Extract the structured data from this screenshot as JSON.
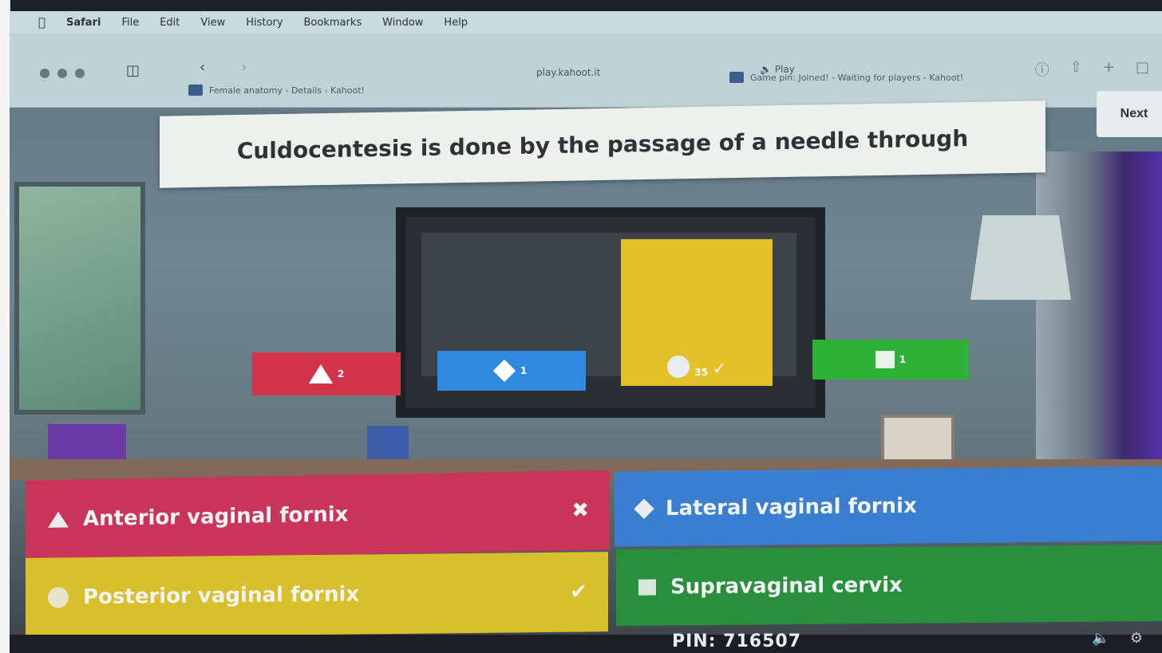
{
  "menubar": {
    "app": "Safari",
    "items": [
      "File",
      "Edit",
      "View",
      "History",
      "Bookmarks",
      "Window",
      "Help"
    ]
  },
  "toolbar": {
    "url": "play.kahoot.it",
    "audio": "Play",
    "tab_left": "Female anatomy - Details - Kahoot!",
    "tab_right": "Game pin: Joined! - Waiting for players - Kahoot!"
  },
  "question": {
    "text": "Culdocentesis is done by the passage of a needle through"
  },
  "next_button": "Next",
  "results": [
    {
      "shape": "triangle-icon",
      "count": "2",
      "color": "#d2324a"
    },
    {
      "shape": "diamond-icon",
      "count": "1",
      "color": "#2f8be0"
    },
    {
      "shape": "circle-icon",
      "count": "35",
      "correct": "✓",
      "color": "#e4c12a"
    },
    {
      "shape": "square-icon",
      "count": "1",
      "color": "#2fb037"
    }
  ],
  "answers": [
    {
      "label": "Anterior vaginal fornix",
      "mark": "✖",
      "color": "#c8345a"
    },
    {
      "label": "Lateral vaginal fornix",
      "color": "#3a7fcf"
    },
    {
      "label": "Posterior vaginal fornix",
      "mark": "✔",
      "color": "#d8c02c"
    },
    {
      "label": "Supravaginal cervix",
      "color": "#2a8f3c"
    }
  ],
  "footer": {
    "pin_text": "PIN: 716507"
  }
}
